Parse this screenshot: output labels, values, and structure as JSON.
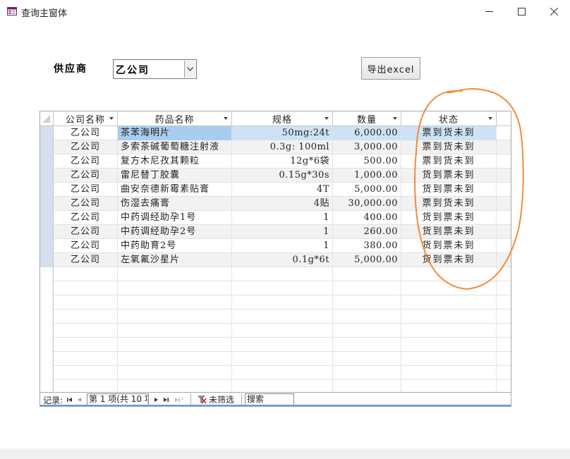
{
  "window": {
    "title": "查询主窗体",
    "minimize_icon": "minimize-icon",
    "maximize_icon": "maximize-icon",
    "close_icon": "close-icon"
  },
  "form": {
    "supplier_label": "供应商",
    "supplier_value": "乙公司",
    "export_label": "导出excel"
  },
  "table": {
    "columns": [
      "公司名称",
      "药品名称",
      "规格",
      "数量",
      "状态"
    ],
    "rows": [
      {
        "company": "乙公司",
        "drug": "茶苯海明片",
        "spec": "50mg:24t",
        "qty": "6,000.00",
        "status": "票到货未到"
      },
      {
        "company": "乙公司",
        "drug": "多索茶碱葡萄糖注射液",
        "spec": "0.3g: 100ml",
        "qty": "3,000.00",
        "status": "票到货未到"
      },
      {
        "company": "乙公司",
        "drug": "复方木尼孜其颗粒",
        "spec": "12g*6袋",
        "qty": "500.00",
        "status": "票到货未到"
      },
      {
        "company": "乙公司",
        "drug": "雷尼替丁胶囊",
        "spec": "0.15g*30s",
        "qty": "1,000.00",
        "status": "货到票未到"
      },
      {
        "company": "乙公司",
        "drug": "曲安奈德新霉素贴膏",
        "spec": "4T",
        "qty": "5,000.00",
        "status": "货到票未到"
      },
      {
        "company": "乙公司",
        "drug": "伤湿去痛膏",
        "spec": "4贴",
        "qty": "30,000.00",
        "status": "票到货未到"
      },
      {
        "company": "乙公司",
        "drug": "中药调经助孕1号",
        "spec": "1",
        "qty": "400.00",
        "status": "货到票未到"
      },
      {
        "company": "乙公司",
        "drug": "中药调经助孕2号",
        "spec": "1",
        "qty": "260.00",
        "status": "货到票未到"
      },
      {
        "company": "乙公司",
        "drug": "中药助育2号",
        "spec": "1",
        "qty": "380.00",
        "status": "货到票未到"
      },
      {
        "company": "乙公司",
        "drug": "左氧氟沙星片",
        "spec": "0.1g*6t",
        "qty": "5,000.00",
        "status": "货到票未到"
      }
    ]
  },
  "navigation": {
    "record_label": "记录:",
    "position": "第 1 项(共 10 项",
    "filter_label": "未筛选",
    "search_label": "搜索"
  },
  "colors": {
    "selected_cell": "#a8cdf0",
    "annotation_stroke": "#f28c38",
    "nav_accent": "#6a9ad6"
  }
}
